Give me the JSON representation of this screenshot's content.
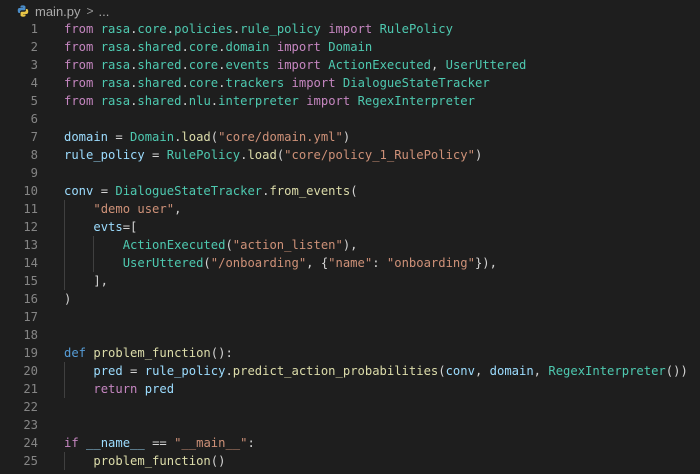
{
  "breadcrumb": {
    "file_name": "main.py",
    "separator": ">",
    "ellipsis": "..."
  },
  "colors": {
    "keyword": "#c586c0",
    "def_keyword": "#569cd6",
    "class_name": "#4ec9b0",
    "function": "#dcdcaa",
    "string": "#ce9178",
    "variable": "#9cdcfe",
    "line_number": "#858585",
    "background": "#1e1e1e"
  },
  "icons": {
    "file_icon": "python-file-icon",
    "separator_icon": "chevron-right-icon"
  },
  "lines": [
    {
      "n": "1",
      "tokens": [
        [
          "kw",
          "from"
        ],
        [
          "pun",
          " "
        ],
        [
          "mod",
          "rasa"
        ],
        [
          "pun",
          "."
        ],
        [
          "mod",
          "core"
        ],
        [
          "pun",
          "."
        ],
        [
          "mod",
          "policies"
        ],
        [
          "pun",
          "."
        ],
        [
          "mod",
          "rule_policy"
        ],
        [
          "pun",
          " "
        ],
        [
          "kw",
          "import"
        ],
        [
          "pun",
          " "
        ],
        [
          "cls",
          "RulePolicy"
        ]
      ]
    },
    {
      "n": "2",
      "tokens": [
        [
          "kw",
          "from"
        ],
        [
          "pun",
          " "
        ],
        [
          "mod",
          "rasa"
        ],
        [
          "pun",
          "."
        ],
        [
          "mod",
          "shared"
        ],
        [
          "pun",
          "."
        ],
        [
          "mod",
          "core"
        ],
        [
          "pun",
          "."
        ],
        [
          "mod",
          "domain"
        ],
        [
          "pun",
          " "
        ],
        [
          "kw",
          "import"
        ],
        [
          "pun",
          " "
        ],
        [
          "cls",
          "Domain"
        ]
      ]
    },
    {
      "n": "3",
      "tokens": [
        [
          "kw",
          "from"
        ],
        [
          "pun",
          " "
        ],
        [
          "mod",
          "rasa"
        ],
        [
          "pun",
          "."
        ],
        [
          "mod",
          "shared"
        ],
        [
          "pun",
          "."
        ],
        [
          "mod",
          "core"
        ],
        [
          "pun",
          "."
        ],
        [
          "mod",
          "events"
        ],
        [
          "pun",
          " "
        ],
        [
          "kw",
          "import"
        ],
        [
          "pun",
          " "
        ],
        [
          "cls",
          "ActionExecuted"
        ],
        [
          "pun",
          ", "
        ],
        [
          "cls",
          "UserUttered"
        ]
      ]
    },
    {
      "n": "4",
      "tokens": [
        [
          "kw",
          "from"
        ],
        [
          "pun",
          " "
        ],
        [
          "mod",
          "rasa"
        ],
        [
          "pun",
          "."
        ],
        [
          "mod",
          "shared"
        ],
        [
          "pun",
          "."
        ],
        [
          "mod",
          "core"
        ],
        [
          "pun",
          "."
        ],
        [
          "mod",
          "trackers"
        ],
        [
          "pun",
          " "
        ],
        [
          "kw",
          "import"
        ],
        [
          "pun",
          " "
        ],
        [
          "cls",
          "DialogueStateTracker"
        ]
      ]
    },
    {
      "n": "5",
      "tokens": [
        [
          "kw",
          "from"
        ],
        [
          "pun",
          " "
        ],
        [
          "mod",
          "rasa"
        ],
        [
          "pun",
          "."
        ],
        [
          "mod",
          "shared"
        ],
        [
          "pun",
          "."
        ],
        [
          "mod",
          "nlu"
        ],
        [
          "pun",
          "."
        ],
        [
          "mod",
          "interpreter"
        ],
        [
          "pun",
          " "
        ],
        [
          "kw",
          "import"
        ],
        [
          "pun",
          " "
        ],
        [
          "cls",
          "RegexInterpreter"
        ]
      ]
    },
    {
      "n": "6",
      "tokens": []
    },
    {
      "n": "7",
      "tokens": [
        [
          "var",
          "domain"
        ],
        [
          "pun",
          " = "
        ],
        [
          "cls",
          "Domain"
        ],
        [
          "pun",
          "."
        ],
        [
          "fn",
          "load"
        ],
        [
          "pun",
          "("
        ],
        [
          "str",
          "\"core/domain.yml\""
        ],
        [
          "pun",
          ")"
        ]
      ]
    },
    {
      "n": "8",
      "tokens": [
        [
          "var",
          "rule_policy"
        ],
        [
          "pun",
          " = "
        ],
        [
          "cls",
          "RulePolicy"
        ],
        [
          "pun",
          "."
        ],
        [
          "fn",
          "load"
        ],
        [
          "pun",
          "("
        ],
        [
          "str",
          "\"core/policy_1_RulePolicy\""
        ],
        [
          "pun",
          ")"
        ]
      ]
    },
    {
      "n": "9",
      "tokens": []
    },
    {
      "n": "10",
      "tokens": [
        [
          "var",
          "conv"
        ],
        [
          "pun",
          " = "
        ],
        [
          "cls",
          "DialogueStateTracker"
        ],
        [
          "pun",
          "."
        ],
        [
          "fn",
          "from_events"
        ],
        [
          "pun",
          "("
        ]
      ]
    },
    {
      "n": "11",
      "tokens": [
        [
          "pun",
          "    "
        ],
        [
          "str",
          "\"demo user\""
        ],
        [
          "pun",
          ","
        ]
      ],
      "guides": [
        1
      ]
    },
    {
      "n": "12",
      "tokens": [
        [
          "pun",
          "    "
        ],
        [
          "var",
          "evts"
        ],
        [
          "pun",
          "=["
        ]
      ],
      "guides": [
        1
      ]
    },
    {
      "n": "13",
      "tokens": [
        [
          "pun",
          "        "
        ],
        [
          "cls",
          "ActionExecuted"
        ],
        [
          "pun",
          "("
        ],
        [
          "str",
          "\"action_listen\""
        ],
        [
          "pun",
          "),"
        ]
      ],
      "guides": [
        1,
        2
      ]
    },
    {
      "n": "14",
      "tokens": [
        [
          "pun",
          "        "
        ],
        [
          "cls",
          "UserUttered"
        ],
        [
          "pun",
          "("
        ],
        [
          "str",
          "\"/onboarding\""
        ],
        [
          "pun",
          ", {"
        ],
        [
          "str",
          "\"name\""
        ],
        [
          "pun",
          ": "
        ],
        [
          "str",
          "\"onboarding\""
        ],
        [
          "pun",
          "}),"
        ]
      ],
      "guides": [
        1,
        2
      ]
    },
    {
      "n": "15",
      "tokens": [
        [
          "pun",
          "    ],"
        ]
      ],
      "guides": [
        1
      ]
    },
    {
      "n": "16",
      "tokens": [
        [
          "pun",
          ")"
        ]
      ]
    },
    {
      "n": "17",
      "tokens": []
    },
    {
      "n": "18",
      "tokens": []
    },
    {
      "n": "19",
      "tokens": [
        [
          "kw2",
          "def"
        ],
        [
          "pun",
          " "
        ],
        [
          "fn",
          "problem_function"
        ],
        [
          "pun",
          "():"
        ]
      ]
    },
    {
      "n": "20",
      "tokens": [
        [
          "pun",
          "    "
        ],
        [
          "var",
          "pred"
        ],
        [
          "pun",
          " = "
        ],
        [
          "var",
          "rule_policy"
        ],
        [
          "pun",
          "."
        ],
        [
          "fn",
          "predict_action_probabilities"
        ],
        [
          "pun",
          "("
        ],
        [
          "var",
          "conv"
        ],
        [
          "pun",
          ", "
        ],
        [
          "var",
          "domain"
        ],
        [
          "pun",
          ", "
        ],
        [
          "cls",
          "RegexInterpreter"
        ],
        [
          "pun",
          "())"
        ]
      ],
      "guides": [
        1
      ]
    },
    {
      "n": "21",
      "tokens": [
        [
          "pun",
          "    "
        ],
        [
          "kw",
          "return"
        ],
        [
          "pun",
          " "
        ],
        [
          "var",
          "pred"
        ]
      ],
      "guides": [
        1
      ]
    },
    {
      "n": "22",
      "tokens": []
    },
    {
      "n": "23",
      "tokens": []
    },
    {
      "n": "24",
      "tokens": [
        [
          "kw",
          "if"
        ],
        [
          "pun",
          " "
        ],
        [
          "var",
          "__name__"
        ],
        [
          "pun",
          " == "
        ],
        [
          "str",
          "\"__main__\""
        ],
        [
          "pun",
          ":"
        ]
      ]
    },
    {
      "n": "25",
      "tokens": [
        [
          "pun",
          "    "
        ],
        [
          "fn",
          "problem_function"
        ],
        [
          "pun",
          "()"
        ]
      ],
      "guides": [
        1
      ]
    }
  ]
}
